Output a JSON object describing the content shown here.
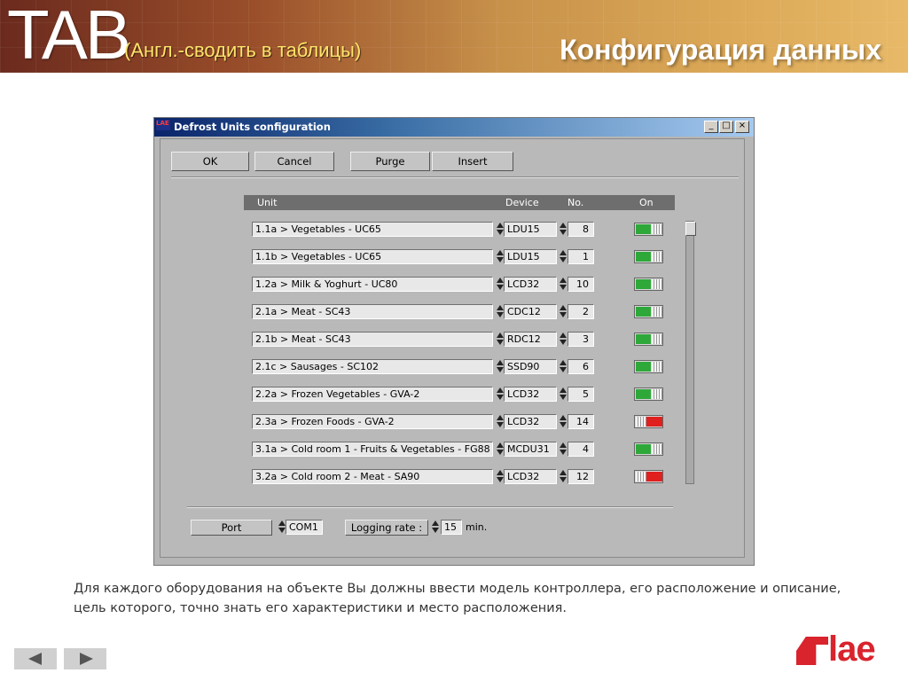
{
  "slide": {
    "tab_text": "TAB",
    "subtitle": "(Англ.-сводить в таблицы)",
    "title": "Конфигурация данных",
    "description": "Для каждого оборудования на объекте Вы должны ввести модель контроллера, его расположение и описание, цель которого, точно знать его характеристики и место расположения.",
    "logo_text": "lae",
    "colors": {
      "accent": "#d9232d",
      "header_dark": "#6b2a1e",
      "header_light": "#e7b968"
    }
  },
  "window": {
    "title": "Defrost Units configuration",
    "app_icon_text": "LAE",
    "controls": [
      "_",
      "□",
      "×"
    ]
  },
  "toolbar": {
    "ok": "OK",
    "cancel": "Cancel",
    "purge": "Purge",
    "insert": "Insert"
  },
  "columns": {
    "unit": "Unit",
    "device": "Device",
    "no": "No.",
    "on": "On"
  },
  "rows": [
    {
      "unit": "1.1a > Vegetables - UC65",
      "device": "LDU15",
      "no": "8",
      "on": true
    },
    {
      "unit": "1.1b > Vegetables - UC65",
      "device": "LDU15",
      "no": "1",
      "on": true
    },
    {
      "unit": "1.2a > Milk & Yoghurt - UC80",
      "device": "LCD32",
      "no": "10",
      "on": true
    },
    {
      "unit": "2.1a > Meat - SC43",
      "device": "CDC12",
      "no": "2",
      "on": true
    },
    {
      "unit": "2.1b > Meat - SC43",
      "device": "RDC12",
      "no": "3",
      "on": true
    },
    {
      "unit": "2.1c > Sausages - SC102",
      "device": "SSD90",
      "no": "6",
      "on": true
    },
    {
      "unit": "2.2a > Frozen Vegetables - GVA-2",
      "device": "LCD32",
      "no": "5",
      "on": true
    },
    {
      "unit": "2.3a > Frozen Foods - GVA-2",
      "device": "LCD32",
      "no": "14",
      "on": false
    },
    {
      "unit": "3.1a > Cold room 1 - Fruits & Vegetables - FG88",
      "device": "MCDU31",
      "no": "4",
      "on": true
    },
    {
      "unit": "3.2a > Cold room 2 - Meat - SA90",
      "device": "LCD32",
      "no": "12",
      "on": false
    }
  ],
  "footer": {
    "port_label": "Port",
    "port_value": "COM1",
    "logging_label": "Logging rate :",
    "logging_value": "15",
    "logging_unit": "min."
  },
  "nav": {
    "prev_icon": "arrow-left-icon",
    "next_icon": "arrow-right-icon"
  }
}
